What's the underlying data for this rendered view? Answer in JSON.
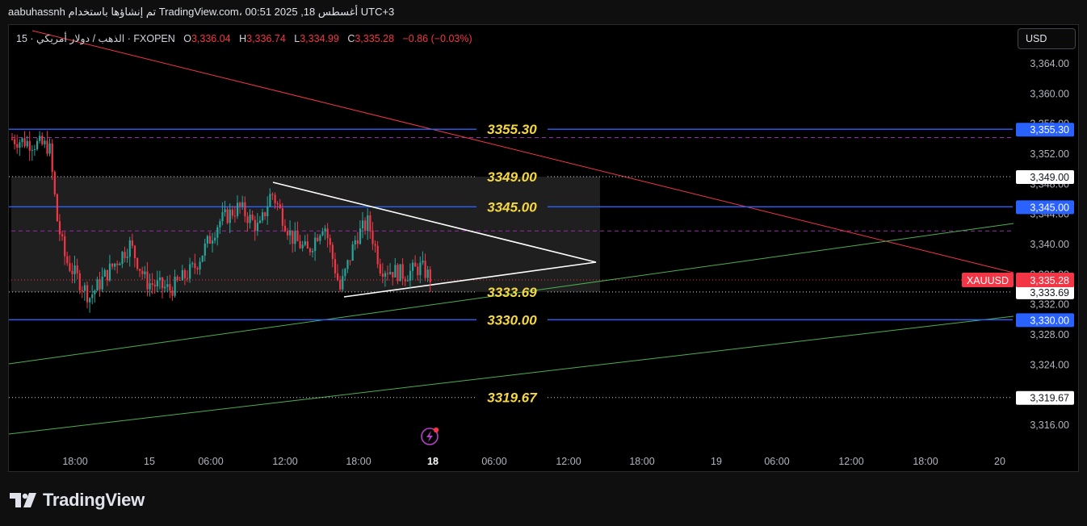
{
  "header": {
    "attribution": "aabuhassnh تم إنشاؤها باستخدام TradingView.com، 00:51 2025 ,18 أغسطس UTC+3"
  },
  "symbol": {
    "name": "15 · الذهب / دولار أمريكي · FXOPEN",
    "open_label": "O",
    "open": "3,336.04",
    "high_label": "H",
    "high": "3,336.74",
    "low_label": "L",
    "low": "3,334.99",
    "close_label": "C",
    "close": "3,335.28",
    "change": "−0.86 (−0.03%)"
  },
  "currency_button": "USD",
  "price_axis": {
    "ticks": [
      "3,364.00",
      "3,360.00",
      "3,356.00",
      "3,352.00",
      "3,348.00",
      "3,344.00",
      "3,340.00",
      "3,336.00",
      "3,332.00",
      "3,328.00",
      "3,324.00",
      "3,316.00"
    ]
  },
  "time_axis": {
    "ticks": [
      "18:00",
      "15",
      "06:00",
      "12:00",
      "18:00",
      "18",
      "06:00",
      "12:00",
      "18:00",
      "19",
      "06:00",
      "12:00",
      "18:00",
      "20"
    ]
  },
  "levels": [
    {
      "label": "3355.30",
      "axis": "3,355.30",
      "style": "blue"
    },
    {
      "label": "3349.00",
      "axis": "3,349.00",
      "style": "dotted"
    },
    {
      "label": "3345.00",
      "axis": "3,345.00",
      "style": "blue"
    },
    {
      "label": "3333.69",
      "axis": "3,333.69",
      "style": "dotted"
    },
    {
      "label": "3330.00",
      "axis": "3,330.00",
      "style": "blue"
    },
    {
      "label": "3319.67",
      "axis": "3,319.67",
      "style": "dotted"
    }
  ],
  "current_price": {
    "symbol": "XAUUSD",
    "price": "3,335.28"
  },
  "colors": {
    "up": "#26a69a",
    "down": "#f23645",
    "blue": "#2962ff",
    "level_text": "#f5d742"
  },
  "footer": {
    "brand": "TradingView"
  }
}
